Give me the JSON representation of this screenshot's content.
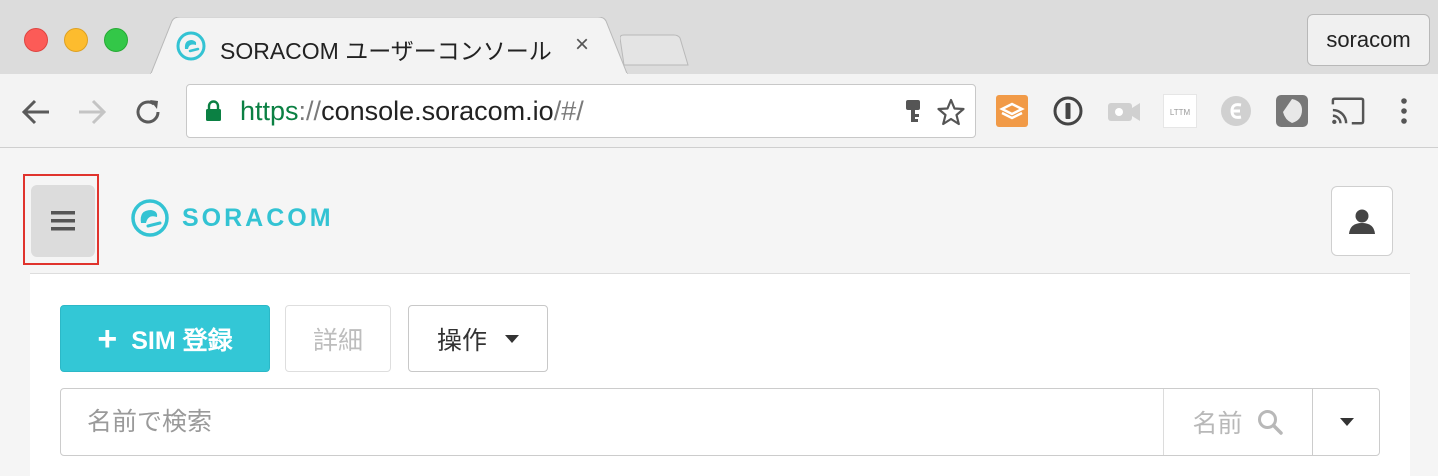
{
  "browser": {
    "tab": {
      "title": "SORACOM ユーザーコンソール",
      "close_glyph": "×"
    },
    "profile_label": "soracom",
    "nav": {
      "back_glyph": "←",
      "forward_glyph": "→",
      "reload_glyph": "↻"
    },
    "url": {
      "scheme": "https",
      "separator": "://",
      "host": "console.soracom.io",
      "path": "/#/"
    },
    "extensions": [
      "layers-icon",
      "password-icon",
      "video-icon",
      "lttm-icon",
      "evernote-icon",
      "shield-icon",
      "cast-icon",
      "more-icon"
    ],
    "lttm_label": "LTTM"
  },
  "header": {
    "brand": "SORACOM"
  },
  "toolbar": {
    "add_label": "SIM 登録",
    "add_glyph": "+",
    "detail_label": "詳細",
    "ops_label": "操作"
  },
  "search": {
    "placeholder": "名前で検索",
    "key_label": "名前"
  },
  "colors": {
    "brand": "#33c3d3",
    "primary_button": "#33c7d6",
    "url_scheme": "#0b8043",
    "highlight": "#e0332d"
  }
}
